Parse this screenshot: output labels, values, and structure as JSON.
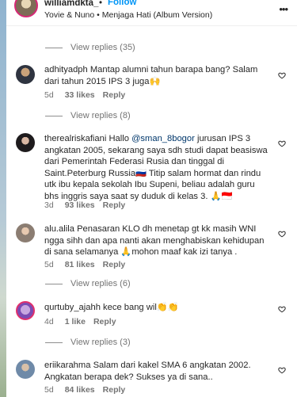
{
  "header": {
    "username": "williamdkta_",
    "dot": "•",
    "follow_label": "Follow",
    "song": "Yovie & Nuno • Menjaga Hati (Album Version)",
    "more_label": "•••"
  },
  "threads": [
    {
      "view_replies": "View replies (35)"
    },
    {
      "username": "adhityadph",
      "text": "Mantap alumni tahun barapa bang? Salam dari tahun 2015 IPS 3 juga🙌",
      "age": "5d",
      "likes": "33 likes",
      "reply_label": "Reply",
      "view_replies": "View replies (8)"
    },
    {
      "username": "therealriskafiani",
      "text_before": "Hallo ",
      "mention": "@sman_8bogor",
      "text_after": " jurusan IPS 3 angkatan 2005, sekarang saya sdh studi dapat beasiswa dari Pemerintah Federasi Rusia dan tinggal di Saint.Peterburg Russia🇷🇺 Titip salam hormat dan rindu utk ibu kepala sekolah Ibu Supeni, beliau adalah guru bhs inggris saya saat sy duduk di kelas 3. 🙏🇮🇩",
      "age": "3d",
      "likes": "93 likes",
      "reply_label": "Reply"
    },
    {
      "username": "alu.alila",
      "text": "Penasaran KLO dh menetap gt kk masih WNI ngga sihh dan apa nanti akan menghabiskan kehidupan di sana selamanya 🙏mohon maaf kak izi tanya .",
      "age": "5d",
      "likes": "81 likes",
      "reply_label": "Reply",
      "view_replies": "View replies (6)"
    },
    {
      "username": "qurtuby_ajahh",
      "text": "kece bang wil👏👏",
      "age": "4d",
      "likes": "1 like",
      "reply_label": "Reply",
      "view_replies": "View replies (3)"
    },
    {
      "username": "eriikarahma",
      "text": "Salam dari kakel SMA 6 angkatan 2002. Angkatan berapa dek? Sukses ya di sana..",
      "age": "5d",
      "likes": "84 likes",
      "reply_label": "Reply"
    }
  ]
}
